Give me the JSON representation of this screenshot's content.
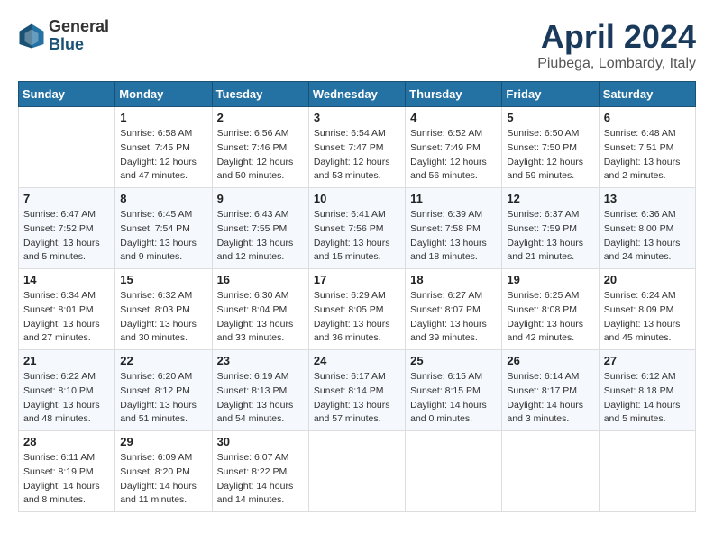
{
  "header": {
    "logo_general": "General",
    "logo_blue": "Blue",
    "title": "April 2024",
    "location": "Piubega, Lombardy, Italy"
  },
  "weekdays": [
    "Sunday",
    "Monday",
    "Tuesday",
    "Wednesday",
    "Thursday",
    "Friday",
    "Saturday"
  ],
  "weeks": [
    [
      {
        "day": "",
        "info": ""
      },
      {
        "day": "1",
        "info": "Sunrise: 6:58 AM\nSunset: 7:45 PM\nDaylight: 12 hours\nand 47 minutes."
      },
      {
        "day": "2",
        "info": "Sunrise: 6:56 AM\nSunset: 7:46 PM\nDaylight: 12 hours\nand 50 minutes."
      },
      {
        "day": "3",
        "info": "Sunrise: 6:54 AM\nSunset: 7:47 PM\nDaylight: 12 hours\nand 53 minutes."
      },
      {
        "day": "4",
        "info": "Sunrise: 6:52 AM\nSunset: 7:49 PM\nDaylight: 12 hours\nand 56 minutes."
      },
      {
        "day": "5",
        "info": "Sunrise: 6:50 AM\nSunset: 7:50 PM\nDaylight: 12 hours\nand 59 minutes."
      },
      {
        "day": "6",
        "info": "Sunrise: 6:48 AM\nSunset: 7:51 PM\nDaylight: 13 hours\nand 2 minutes."
      }
    ],
    [
      {
        "day": "7",
        "info": "Sunrise: 6:47 AM\nSunset: 7:52 PM\nDaylight: 13 hours\nand 5 minutes."
      },
      {
        "day": "8",
        "info": "Sunrise: 6:45 AM\nSunset: 7:54 PM\nDaylight: 13 hours\nand 9 minutes."
      },
      {
        "day": "9",
        "info": "Sunrise: 6:43 AM\nSunset: 7:55 PM\nDaylight: 13 hours\nand 12 minutes."
      },
      {
        "day": "10",
        "info": "Sunrise: 6:41 AM\nSunset: 7:56 PM\nDaylight: 13 hours\nand 15 minutes."
      },
      {
        "day": "11",
        "info": "Sunrise: 6:39 AM\nSunset: 7:58 PM\nDaylight: 13 hours\nand 18 minutes."
      },
      {
        "day": "12",
        "info": "Sunrise: 6:37 AM\nSunset: 7:59 PM\nDaylight: 13 hours\nand 21 minutes."
      },
      {
        "day": "13",
        "info": "Sunrise: 6:36 AM\nSunset: 8:00 PM\nDaylight: 13 hours\nand 24 minutes."
      }
    ],
    [
      {
        "day": "14",
        "info": "Sunrise: 6:34 AM\nSunset: 8:01 PM\nDaylight: 13 hours\nand 27 minutes."
      },
      {
        "day": "15",
        "info": "Sunrise: 6:32 AM\nSunset: 8:03 PM\nDaylight: 13 hours\nand 30 minutes."
      },
      {
        "day": "16",
        "info": "Sunrise: 6:30 AM\nSunset: 8:04 PM\nDaylight: 13 hours\nand 33 minutes."
      },
      {
        "day": "17",
        "info": "Sunrise: 6:29 AM\nSunset: 8:05 PM\nDaylight: 13 hours\nand 36 minutes."
      },
      {
        "day": "18",
        "info": "Sunrise: 6:27 AM\nSunset: 8:07 PM\nDaylight: 13 hours\nand 39 minutes."
      },
      {
        "day": "19",
        "info": "Sunrise: 6:25 AM\nSunset: 8:08 PM\nDaylight: 13 hours\nand 42 minutes."
      },
      {
        "day": "20",
        "info": "Sunrise: 6:24 AM\nSunset: 8:09 PM\nDaylight: 13 hours\nand 45 minutes."
      }
    ],
    [
      {
        "day": "21",
        "info": "Sunrise: 6:22 AM\nSunset: 8:10 PM\nDaylight: 13 hours\nand 48 minutes."
      },
      {
        "day": "22",
        "info": "Sunrise: 6:20 AM\nSunset: 8:12 PM\nDaylight: 13 hours\nand 51 minutes."
      },
      {
        "day": "23",
        "info": "Sunrise: 6:19 AM\nSunset: 8:13 PM\nDaylight: 13 hours\nand 54 minutes."
      },
      {
        "day": "24",
        "info": "Sunrise: 6:17 AM\nSunset: 8:14 PM\nDaylight: 13 hours\nand 57 minutes."
      },
      {
        "day": "25",
        "info": "Sunrise: 6:15 AM\nSunset: 8:15 PM\nDaylight: 14 hours\nand 0 minutes."
      },
      {
        "day": "26",
        "info": "Sunrise: 6:14 AM\nSunset: 8:17 PM\nDaylight: 14 hours\nand 3 minutes."
      },
      {
        "day": "27",
        "info": "Sunrise: 6:12 AM\nSunset: 8:18 PM\nDaylight: 14 hours\nand 5 minutes."
      }
    ],
    [
      {
        "day": "28",
        "info": "Sunrise: 6:11 AM\nSunset: 8:19 PM\nDaylight: 14 hours\nand 8 minutes."
      },
      {
        "day": "29",
        "info": "Sunrise: 6:09 AM\nSunset: 8:20 PM\nDaylight: 14 hours\nand 11 minutes."
      },
      {
        "day": "30",
        "info": "Sunrise: 6:07 AM\nSunset: 8:22 PM\nDaylight: 14 hours\nand 14 minutes."
      },
      {
        "day": "",
        "info": ""
      },
      {
        "day": "",
        "info": ""
      },
      {
        "day": "",
        "info": ""
      },
      {
        "day": "",
        "info": ""
      }
    ]
  ]
}
